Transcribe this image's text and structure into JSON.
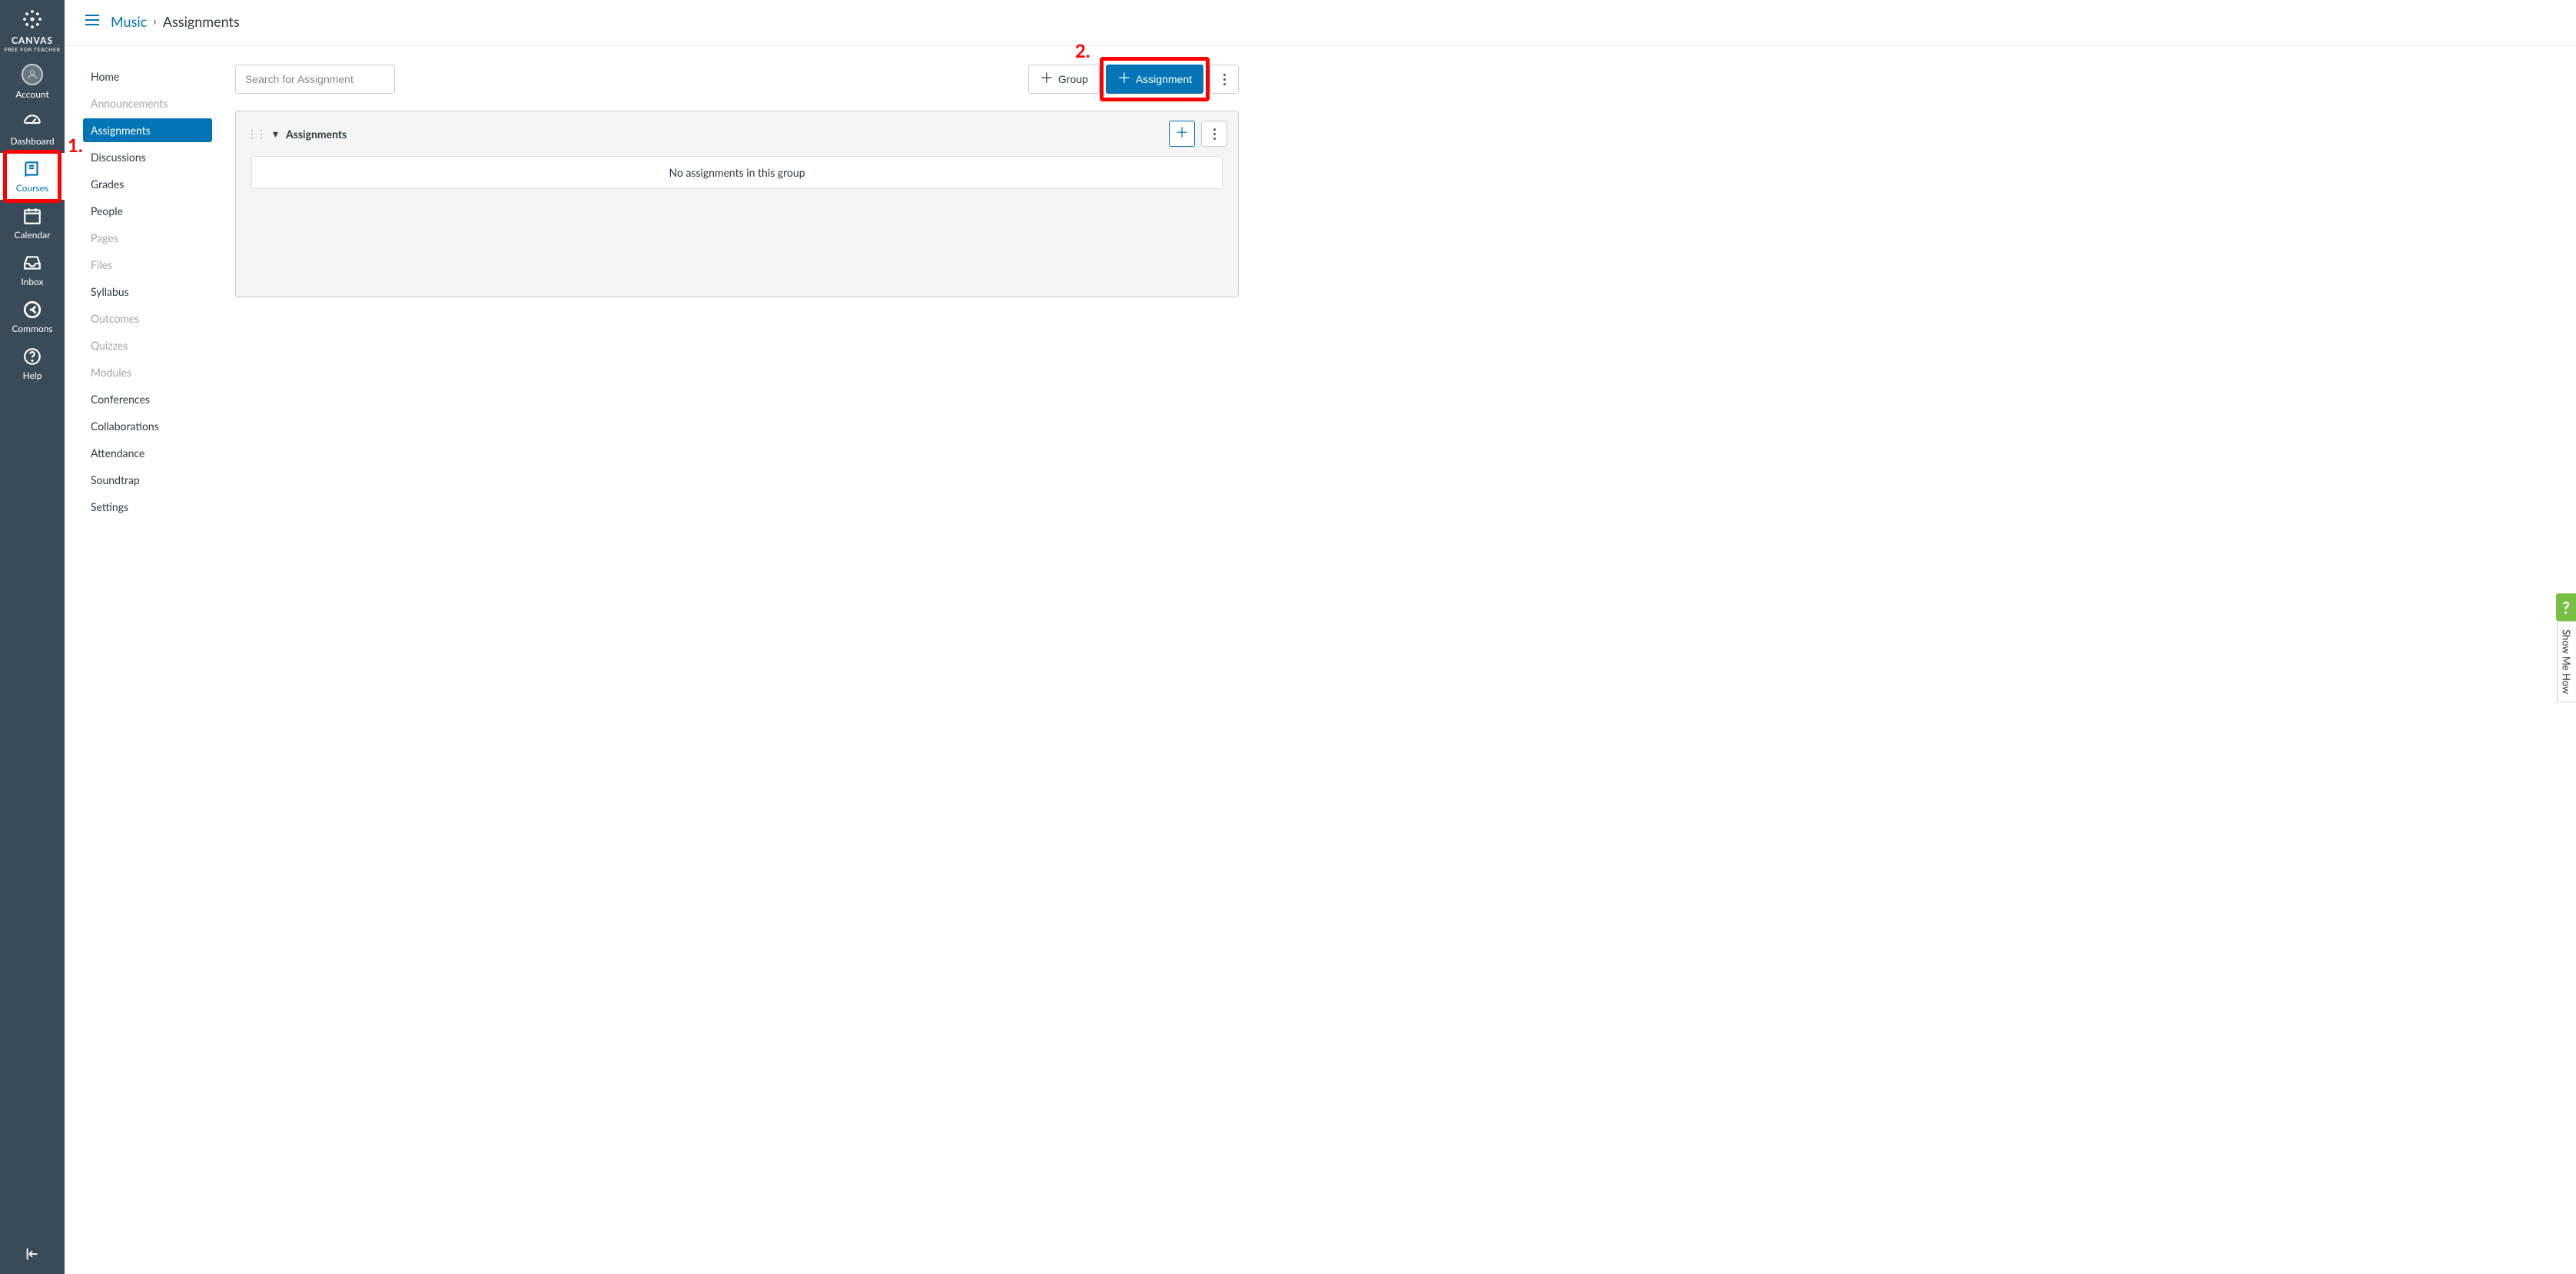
{
  "brand": {
    "name": "CANVAS",
    "sub": "FREE FOR TEACHER"
  },
  "global_nav": {
    "account": "Account",
    "dashboard": "Dashboard",
    "courses": "Courses",
    "calendar": "Calendar",
    "inbox": "Inbox",
    "commons": "Commons",
    "help": "Help"
  },
  "breadcrumb": {
    "course": "Music",
    "page": "Assignments"
  },
  "course_nav": {
    "home": "Home",
    "announcements": "Announcements",
    "assignments": "Assignments",
    "discussions": "Discussions",
    "grades": "Grades",
    "people": "People",
    "pages": "Pages",
    "files": "Files",
    "syllabus": "Syllabus",
    "outcomes": "Outcomes",
    "quizzes": "Quizzes",
    "modules": "Modules",
    "conferences": "Conferences",
    "collaborations": "Collaborations",
    "attendance": "Attendance",
    "soundtrap": "Soundtrap",
    "settings": "Settings"
  },
  "toolbar": {
    "search_placeholder": "Search for Assignment",
    "group_btn": "Group",
    "assignment_btn": "Assignment"
  },
  "group": {
    "title": "Assignments",
    "empty": "No assignments in this group"
  },
  "annotations": {
    "one": "1.",
    "two": "2."
  },
  "help_panel": {
    "q": "?",
    "text": "Show Me How"
  }
}
